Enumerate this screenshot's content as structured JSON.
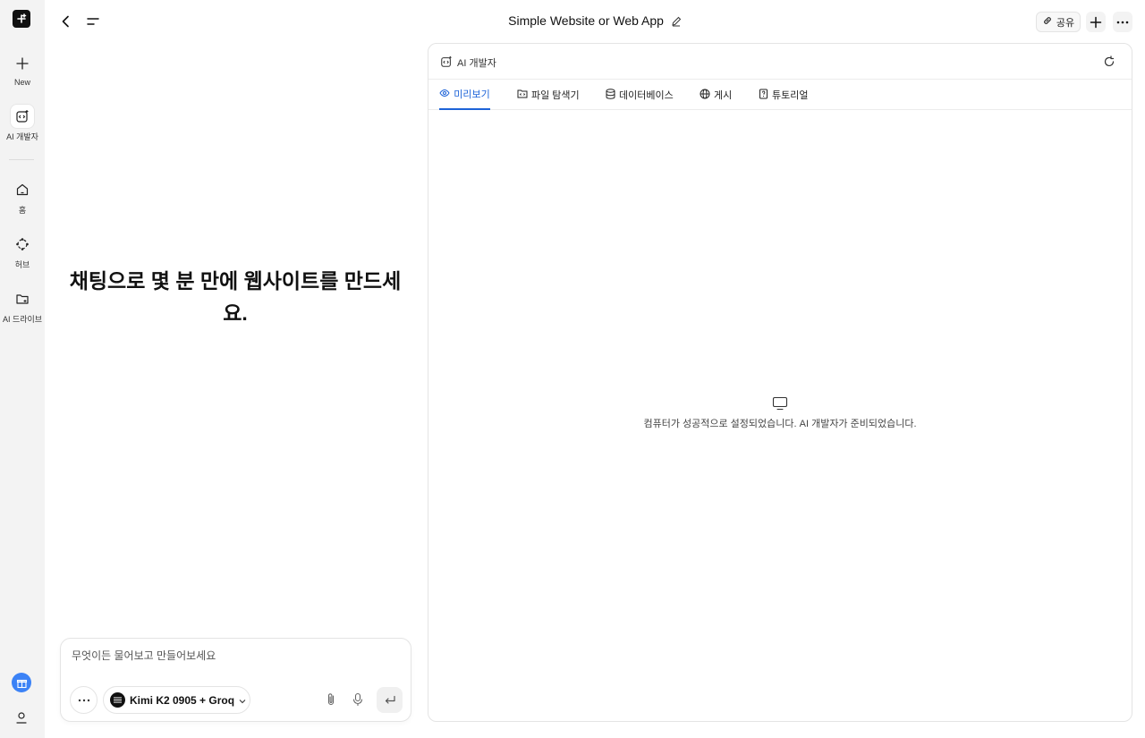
{
  "rail": {
    "items": [
      {
        "label": "New",
        "icon": "plus-icon"
      },
      {
        "label": "AI 개발자",
        "icon": "code-sparkle-icon",
        "active": true
      },
      {
        "label": "홈",
        "icon": "home-icon"
      },
      {
        "label": "허브",
        "icon": "hub-icon"
      },
      {
        "label": "AI 드라이브",
        "icon": "folder-icon"
      }
    ]
  },
  "header": {
    "title": "Simple Website or Web App",
    "share_label": "공유"
  },
  "chat": {
    "hero_title": "채팅으로 몇 분 만에 웹사이트를 만드세요.",
    "input_placeholder": "무엇이든 물어보고 만들어보세요",
    "model_label": "Kimi K2 0905 + Groq"
  },
  "panel": {
    "title": "AI 개발자",
    "tabs": [
      {
        "label": "미리보기",
        "icon": "eye-icon",
        "active": true
      },
      {
        "label": "파일 탐색기",
        "icon": "folder-code-icon"
      },
      {
        "label": "데이터베이스",
        "icon": "database-icon"
      },
      {
        "label": "게시",
        "icon": "globe-icon"
      },
      {
        "label": "튜토리얼",
        "icon": "book-icon"
      }
    ],
    "status_message": "컴퓨터가 성공적으로 설정되었습니다. AI 개발자가 준비되었습니다."
  },
  "colors": {
    "accent": "#1d63d8",
    "rail_bg": "#f3f3f3",
    "gift": "#3b82f6"
  }
}
